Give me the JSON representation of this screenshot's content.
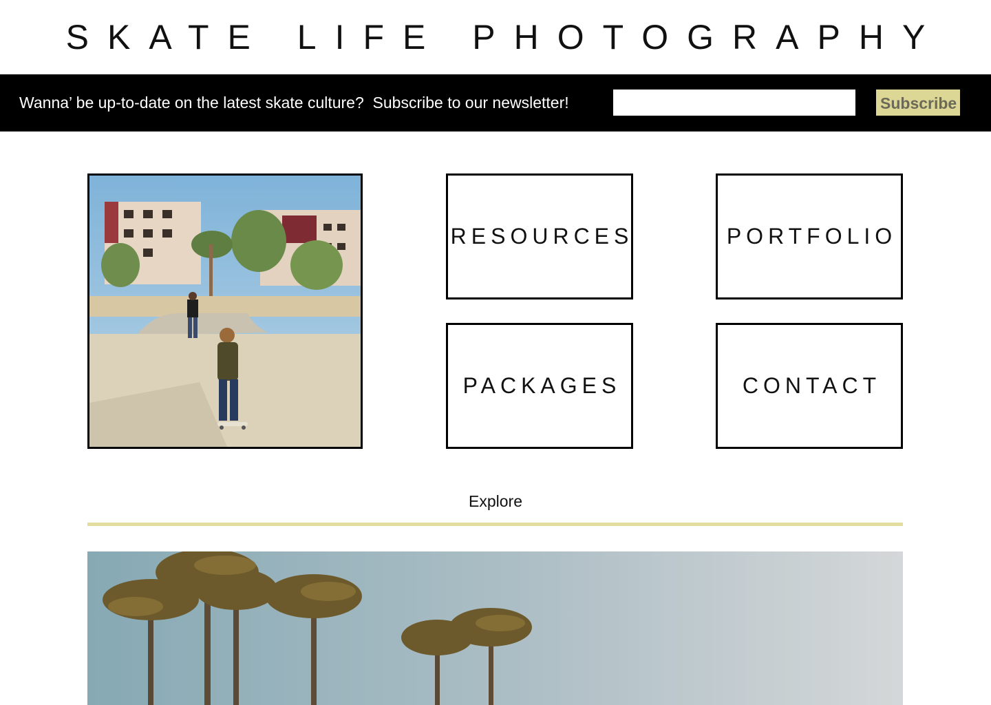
{
  "site": {
    "title": "SKATE LIFE PHOTOGRAPHY"
  },
  "newsletter": {
    "message": "Wanna’ be up-to-date on the latest skate culture?  Subscribe to our newsletter!",
    "input_value": "",
    "input_placeholder": "",
    "subscribe_label": "Subscribe"
  },
  "nav": {
    "resources_label": "RESOURCES",
    "portfolio_label": "PORTFOLIO",
    "packages_label": "PACKAGES",
    "contact_label": "CONTACT"
  },
  "explore": {
    "label": "Explore"
  },
  "images": {
    "hero": "skateboarder-at-skatepark-photo",
    "banner": "palm-trees-sky-photo"
  },
  "colors": {
    "bar_background": "#000000",
    "accent": "#ddd795",
    "divider": "#e2dd9f",
    "border": "#000000"
  }
}
